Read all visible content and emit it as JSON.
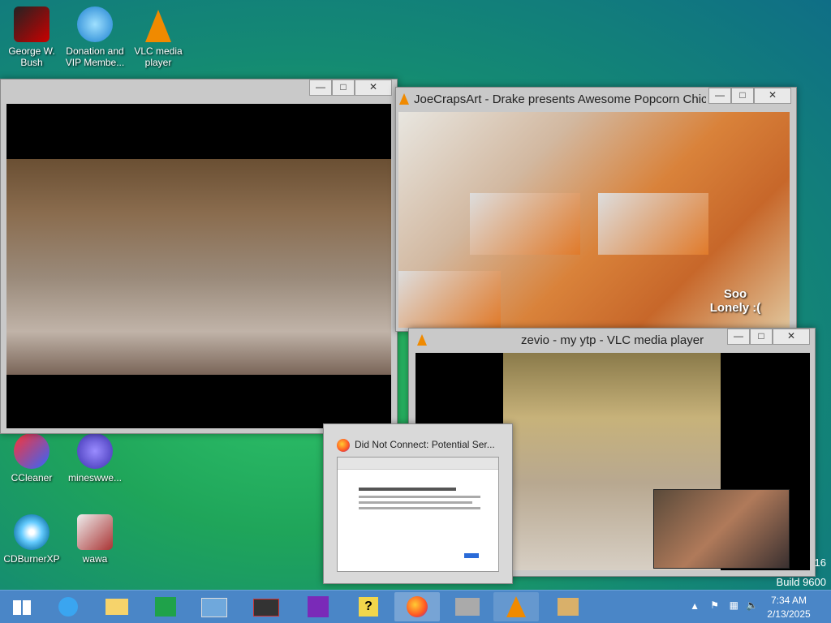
{
  "desktop_icons": [
    {
      "label": "George W. Bush"
    },
    {
      "label": "Donation and VIP Membe..."
    },
    {
      "label": "VLC media player"
    },
    {
      "label": "CCleaner"
    },
    {
      "label": "mineswwe..."
    },
    {
      "label": "CDBurnerXP"
    },
    {
      "label": "wawa"
    }
  ],
  "windows": {
    "left_video": {
      "title": ""
    },
    "popcorn": {
      "title": "JoeCrapsArt - Drake presents Awesome Popcorn Chic...",
      "caption": "Soo\nLonely :("
    },
    "zevio": {
      "title": "zevio - my ytp - VLC media player"
    },
    "firefox_thumb": {
      "title": "Did Not Connect: Potential Ser..."
    }
  },
  "watermark": {
    "line1": "16",
    "line2": "Build 9600"
  },
  "taskbar": {
    "time": "7:34 AM",
    "date": "2/13/2025"
  },
  "colors": {
    "taskbar": "#4a86c7",
    "vlc_orange": "#f08a00"
  }
}
